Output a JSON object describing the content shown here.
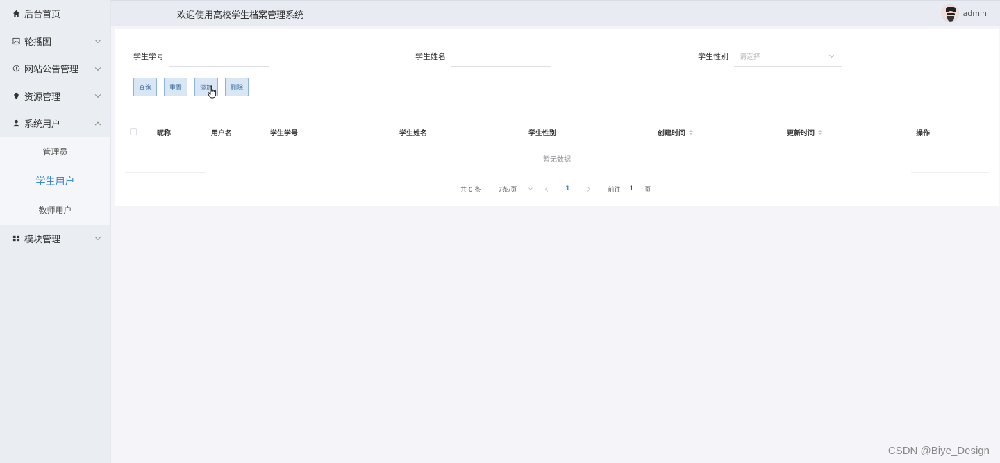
{
  "sidebar": {
    "items": [
      {
        "label": "后台首页",
        "icon": "home-icon"
      },
      {
        "label": "轮播图",
        "icon": "image-icon"
      },
      {
        "label": "网站公告管理",
        "icon": "info-circle-icon"
      },
      {
        "label": "资源管理",
        "icon": "location-icon"
      },
      {
        "label": "系统用户",
        "icon": "user-icon"
      },
      {
        "label": "模块管理",
        "icon": "grid-icon"
      }
    ],
    "submenu": [
      {
        "label": "管理员"
      },
      {
        "label": "学生用户"
      },
      {
        "label": "教师用户"
      }
    ]
  },
  "header": {
    "title": "欢迎使用高校学生档案管理系统",
    "username": "admin"
  },
  "search": {
    "student_id_label": "学生学号",
    "student_name_label": "学生姓名",
    "student_gender_label": "学生性别",
    "gender_placeholder": "请选择"
  },
  "buttons": {
    "query": "查询",
    "reset": "重置",
    "add": "添加",
    "delete": "删除"
  },
  "table": {
    "columns": [
      "昵称",
      "用户名",
      "学生学号",
      "学生姓名",
      "学生性别",
      "创建时间",
      "更新时间",
      "操作"
    ],
    "empty_text": "暂无数据"
  },
  "pagination": {
    "total": "共 0 条",
    "page_size": "7条/页",
    "current_page": "1",
    "goto_label": "前往",
    "goto_value": "1",
    "page_suffix": "页"
  },
  "watermark": "CSDN @Biye_Design",
  "colors": {
    "accent": "#3a86d8",
    "sidebar_bg": "#eaedf2",
    "button_bg": "#d9e7f5"
  }
}
